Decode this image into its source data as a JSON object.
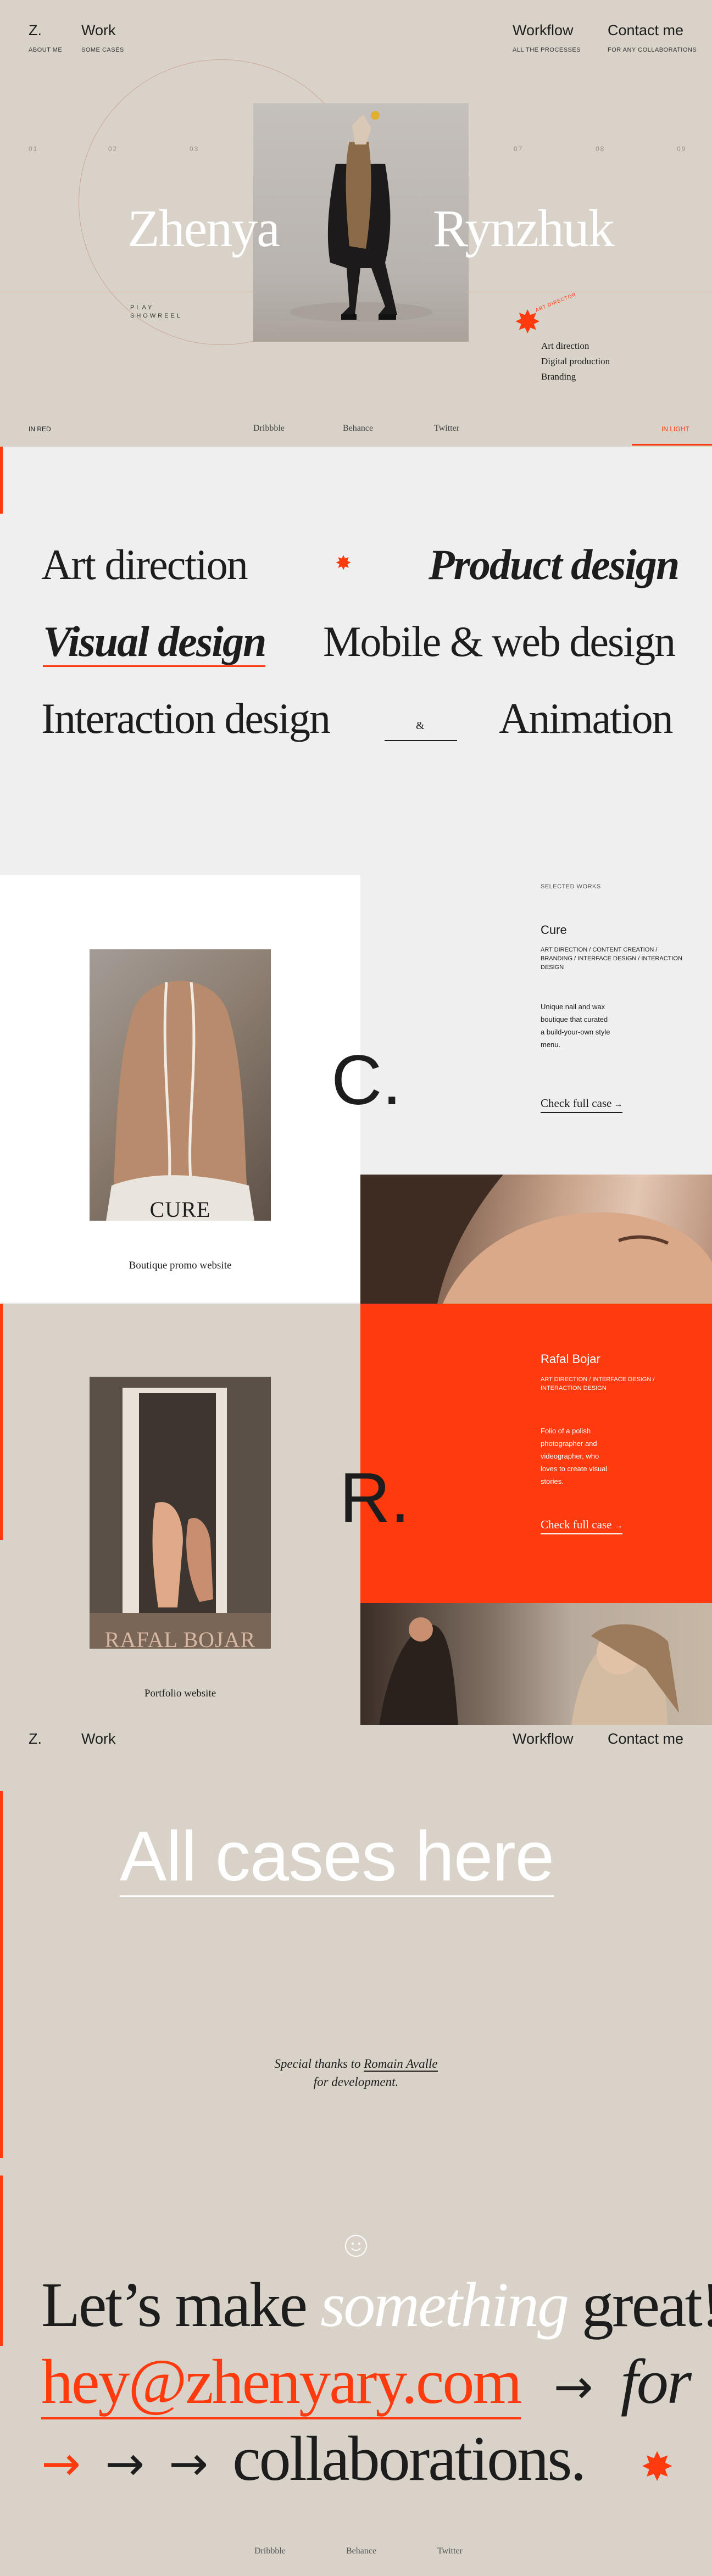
{
  "nav": {
    "logo": "Z.",
    "about": "ABOUT ME",
    "work": "Work",
    "work_sub": "SOME CASES",
    "workflow": "Workflow",
    "workflow_sub": "ALL THE PROCESSES",
    "contact": "Contact me",
    "contact_sub": "FOR ANY COLLABORATIONS"
  },
  "hero": {
    "numbers_left": [
      "01",
      "02",
      "03"
    ],
    "numbers_right": [
      "07",
      "08",
      "09"
    ],
    "first_name": "Zhenya",
    "last_name": "Rynzhuk",
    "showreel_line1": "PLAY",
    "showreel_line2": "SHOWREEL",
    "stamp": "ART DIRECTOR",
    "services": [
      "Art direction",
      "Digital production",
      "Branding"
    ],
    "mode_left": "IN RED",
    "mode_right": "IN LIGHT",
    "links": [
      "Dribbble",
      "Behance",
      "Twitter"
    ],
    "accent_color": "#ff3a0e",
    "star_icon": "asterisk-star-icon"
  },
  "services_list": {
    "items": [
      "Art direction",
      "Product design",
      "Visual design",
      "Mobile & web design",
      "Interaction design",
      "Animation"
    ],
    "ampersand": "&"
  },
  "cure": {
    "photo_title": "CURE",
    "caption": "Boutique promo website",
    "letter": "C.",
    "label": "SELECTED WORKS",
    "name": "Cure",
    "tags": "ART DIRECTION / CONTENT CREATION / BRANDING / INTERFACE DESIGN / INTERACTION DESIGN",
    "description": "Unique nail and wax boutique that curated a build-your-own style menu.",
    "link": "Check full case"
  },
  "rafal": {
    "photo_title": "RAFAL BOJAR",
    "caption": "Portfolio website",
    "letter": "R.",
    "name": "Rafal Bojar",
    "tags": "ART DIRECTION / INTERFACE DESIGN / INTERACTION DESIGN",
    "description": "Folio of a polish photographer and videographer, who loves to create visual stories.",
    "link": "Check full case"
  },
  "all_cases": {
    "title": "All cases here",
    "thanks_prefix": "Special thanks to ",
    "thanks_name": "Romain Avalle",
    "thanks_suffix": "for development."
  },
  "contact": {
    "line1_a": "Let’s make ",
    "line1_b": "something",
    "line1_c": " great!",
    "email": "hey@zhenyary.com",
    "for": "for",
    "line3": "collaborations.",
    "links": [
      "Dribbble",
      "Behance",
      "Twitter"
    ]
  }
}
